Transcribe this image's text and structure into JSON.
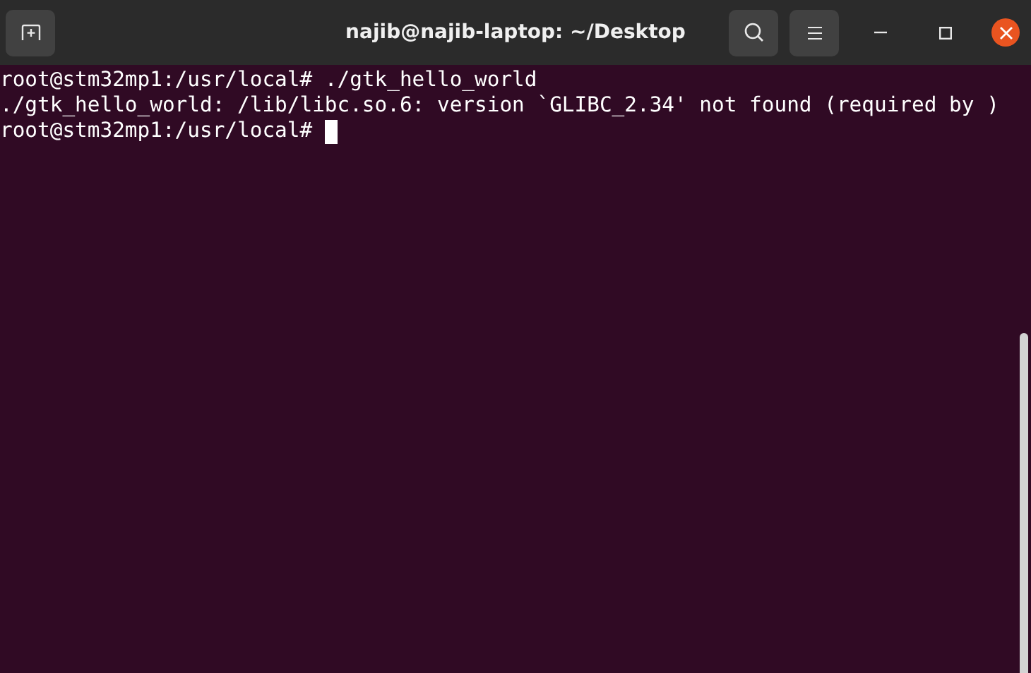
{
  "window": {
    "title": "najib@najib-laptop: ~/Desktop"
  },
  "terminal": {
    "lines": [
      {
        "text": "root@stm32mp1:/usr/local# ./gtk_hello_world",
        "cursor": false
      },
      {
        "text": "./gtk_hello_world: /lib/libc.so.6: version `GLIBC_2.34' not found (required by )",
        "cursor": false
      },
      {
        "text": "root@stm32mp1:/usr/local# ",
        "cursor": true
      }
    ]
  }
}
